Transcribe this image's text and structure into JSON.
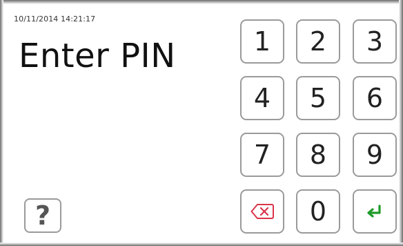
{
  "status": {
    "timestamp": "10/11/2014 14:21:17"
  },
  "prompt": {
    "title": "Enter PIN"
  },
  "keypad": {
    "keys": [
      "1",
      "2",
      "3",
      "4",
      "5",
      "6",
      "7",
      "8",
      "9",
      "0"
    ],
    "backspace_icon": "backspace-icon",
    "enter_icon": "enter-icon",
    "colors": {
      "backspace": "#d9334a",
      "enter": "#1f9b2a",
      "border": "#9a9a9a"
    }
  },
  "help": {
    "label": "?"
  }
}
